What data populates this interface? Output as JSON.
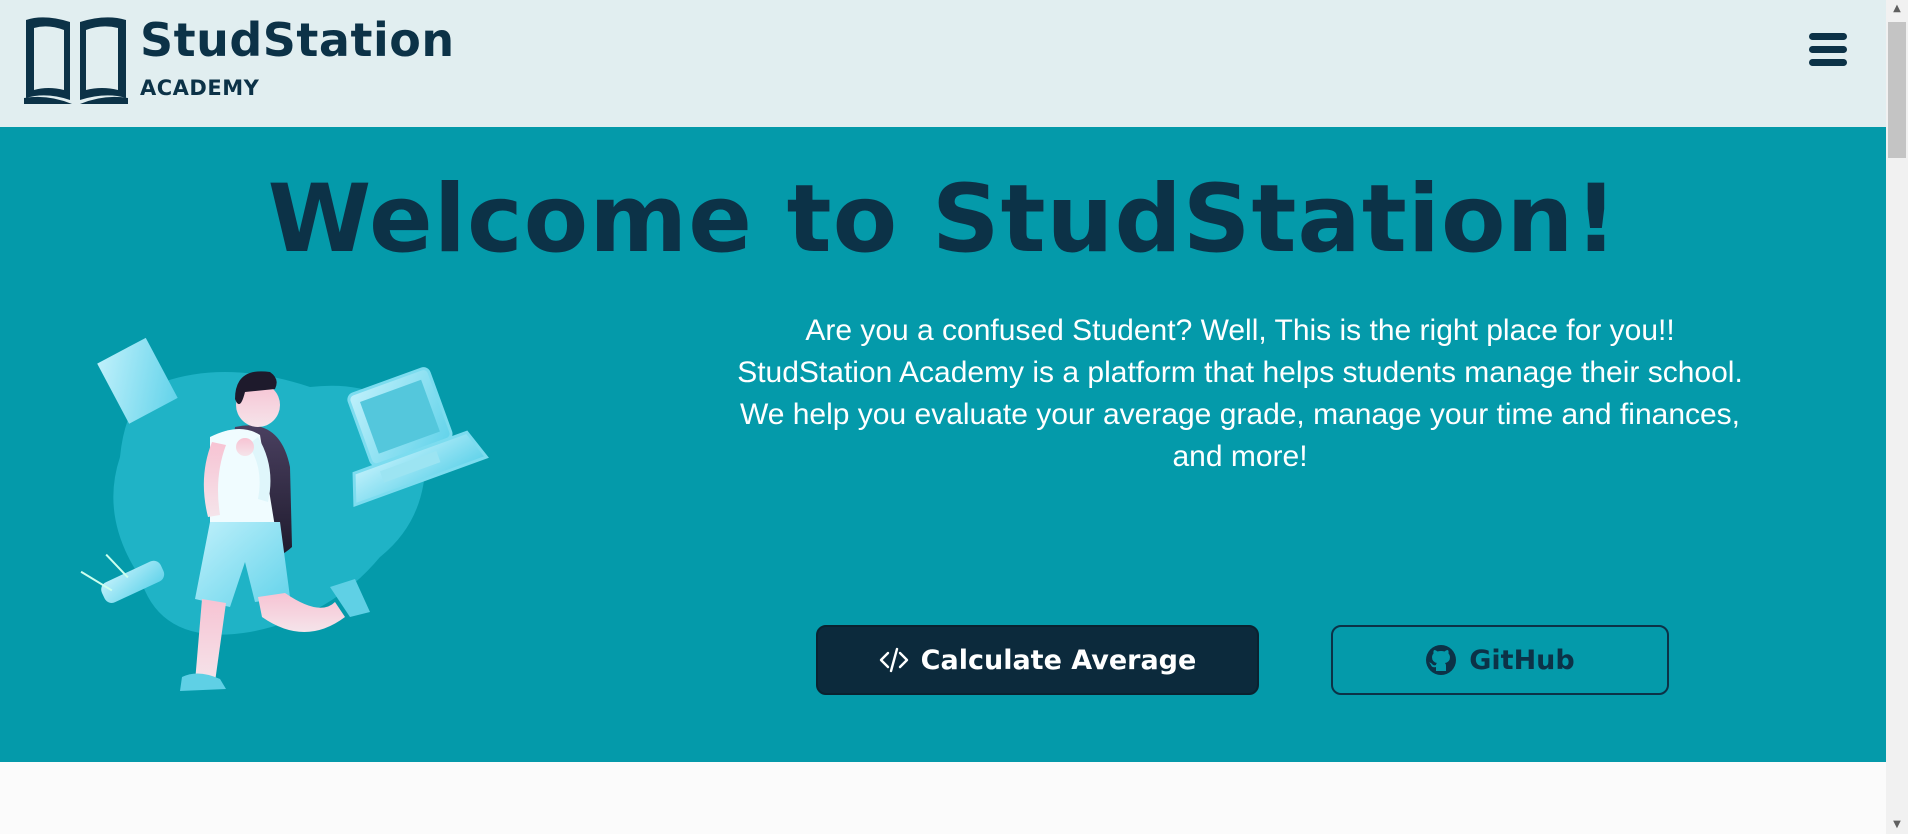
{
  "header": {
    "brand_name": "StudStation",
    "brand_sub": "ACADEMY",
    "logo_icon": "open-book-icon",
    "menu_icon": "hamburger-menu-icon"
  },
  "hero": {
    "title": "Welcome to StudStation!",
    "lines": [
      "Are you a confused Student? Well, This is the right place for you!!",
      "StudStation Academy is a platform that helps students manage their school.",
      "We help you evaluate your average grade, manage your time and finances,",
      "and more!"
    ],
    "primary_button": {
      "label": "Calculate Average",
      "icon": "code-icon"
    },
    "secondary_button": {
      "label": "GitHub",
      "icon": "github-icon"
    }
  },
  "colors": {
    "header_bg": "#e1eef0",
    "hero_bg": "#049aaa",
    "brand_dark": "#0c3247",
    "button_dark": "#0c2a3c",
    "text_light": "#ffffff"
  }
}
